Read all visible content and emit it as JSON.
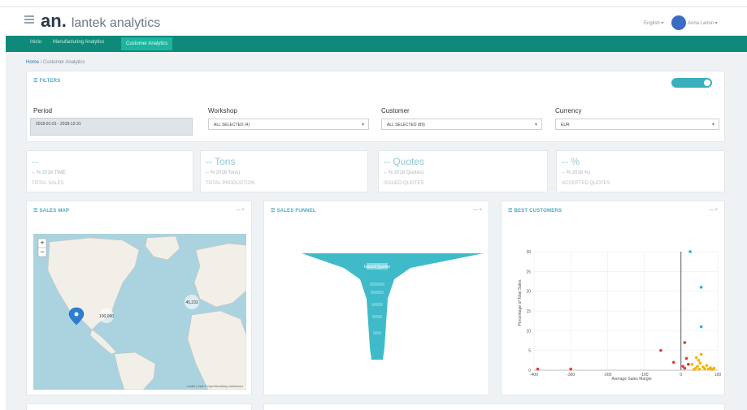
{
  "header": {
    "logo_mark": "an",
    "logo_text": "lantek analytics",
    "language": "English",
    "user_name": "Anna Lamin"
  },
  "nav": {
    "tabs": [
      {
        "label": "Inicio"
      },
      {
        "label": "Manufacturing Analytics"
      },
      {
        "label": "Customer Analytics"
      }
    ],
    "active_index": 2
  },
  "breadcrumb": {
    "home": "Home",
    "separator": "/",
    "current": "Customer Analytics"
  },
  "filters": {
    "title": "FILTERS",
    "period_label": "Period",
    "period_value": "2018-01-01 - 2018-12-31",
    "workshop_label": "Workshop",
    "workshop_value": "ALL SELECTED (4)",
    "customer_label": "Customer",
    "customer_value": "ALL SELECTED (89)",
    "currency_label": "Currency",
    "currency_value": "EUR"
  },
  "kpis": [
    {
      "top": "--",
      "mid": "-- % 2018 TIME",
      "bot": "TOTAL SALES"
    },
    {
      "top": "-- Tons",
      "mid": "-- % 2018 Tons)",
      "bot": "TOTAL PRODUCTION"
    },
    {
      "top": "-- Quotes",
      "mid": "-- % 2018 Quotes)",
      "bot": "ISSUED QUOTES"
    },
    {
      "top": "-- %",
      "mid": "-- % 2018 %)",
      "bot": "ACCEPTED QUOTES"
    }
  ],
  "sales_map": {
    "title": "SALES MAP",
    "zoom_in": "+",
    "zoom_out": "−",
    "cluster_labels": [
      "100,000",
      "45,233"
    ],
    "attribution": "Leaflet | Data © OpenStreetMap contributors"
  },
  "sales_funnel": {
    "title": "SALES FUNNEL",
    "top_label": "Issued Quotes"
  },
  "best_customers": {
    "title": "BEST CUSTOMERS",
    "xlabel": "Average Sales Margin",
    "ylabel": "Percentage of Total Sales"
  },
  "panel_controls": "— ×",
  "chart_data": {
    "type": "scatter",
    "title": "BEST CUSTOMERS",
    "xlabel": "Average Sales Margin",
    "ylabel": "Percentage of Total Sales",
    "x_ticks": [
      -400,
      -300,
      -200,
      -100,
      0,
      100
    ],
    "y_ticks": [
      0,
      5,
      10,
      15,
      20,
      25,
      30
    ],
    "xlim": [
      -400,
      100
    ],
    "ylim": [
      0,
      30
    ],
    "grid": true,
    "series": [
      {
        "color": "#2fb3c9",
        "points": [
          [
            25,
            30
          ],
          [
            55,
            21
          ],
          [
            55,
            11
          ]
        ]
      },
      {
        "color": "#e53935",
        "points": [
          [
            -390,
            0.3
          ],
          [
            -300,
            0.3
          ],
          [
            -55,
            5
          ],
          [
            -20,
            2
          ],
          [
            5,
            1
          ],
          [
            10,
            7
          ],
          [
            15,
            3
          ],
          [
            20,
            1.5
          ],
          [
            10,
            0.5
          ]
        ]
      },
      {
        "color": "#f5b301",
        "points": [
          [
            30,
            1.5
          ],
          [
            40,
            0.5
          ],
          [
            45,
            1
          ],
          [
            48,
            2.5
          ],
          [
            50,
            0.3
          ],
          [
            55,
            4
          ],
          [
            60,
            0.8
          ],
          [
            65,
            0.4
          ],
          [
            70,
            1.2
          ],
          [
            75,
            0.3
          ],
          [
            80,
            0.6
          ],
          [
            85,
            0.2
          ],
          [
            35,
            0.2
          ],
          [
            42,
            3.2
          ],
          [
            52,
            1.8
          ],
          [
            90,
            0.5
          ]
        ]
      }
    ]
  }
}
